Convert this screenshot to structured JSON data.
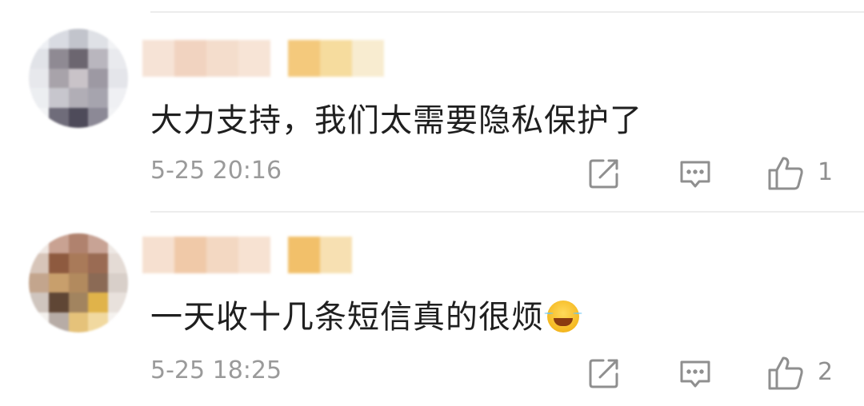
{
  "comments": [
    {
      "text": "大力支持，我们太需要隐私保护了",
      "time": "5-25 20:16",
      "likes": "1",
      "avatar_colors": [
        "#eef0f4",
        "#d9dbe2",
        "#c2c4cc",
        "#dfe1e6",
        "#f2f3f5",
        "#e1e3e8",
        "#8f8a93",
        "#6c6670",
        "#b9b6be",
        "#e9eaee",
        "#e7e8ec",
        "#a8a3aa",
        "#c9c3c8",
        "#9d99a3",
        "#e4e5ea",
        "#eceef1",
        "#c7c6cd",
        "#b1aeb6",
        "#a6a4ae",
        "#eff0f3",
        "#f3f4f6",
        "#6f6c7a",
        "#4e4b5a",
        "#8c8996",
        "#f2f3f5"
      ],
      "name_colors": [
        "#f6e3d6",
        "#f1d3c0",
        "#f4ddcc",
        "#f7e4d6",
        "gap",
        "#f4c97c",
        "#f6dc9e",
        "#f8ecd0"
      ]
    },
    {
      "text": "一天收十几条短信真的很烦",
      "time": "5-25 18:25",
      "likes": "2",
      "avatar_colors": [
        "#efe7e2",
        "#c9a292",
        "#b0826e",
        "#c8a395",
        "#eee8e4",
        "#d7c5b9",
        "#8e5a3f",
        "#a97a59",
        "#9a6b53",
        "#e4dbd5",
        "#c3a58d",
        "#c89f6c",
        "#b28a5e",
        "#8b6a55",
        "#d8cfc9",
        "#cfc5be",
        "#5f4635",
        "#a2845f",
        "#e0b34a",
        "#e8e1dc",
        "#f4f1ee",
        "#b7aca6",
        "#e5c27a",
        "#f1d9a0",
        "#f5f2ef"
      ],
      "name_colors": [
        "#f6e0d0",
        "#f0c9a8",
        "#f3d8c2",
        "#f7e2d2",
        "gap",
        "#f2c06a",
        "#f7e0b2"
      ]
    }
  ],
  "icons": {
    "share": "share-icon",
    "reply": "comment-icon",
    "like": "thumbs-up-icon"
  },
  "colors": {
    "text": "#1f1f1f",
    "meta": "#9a9a9a",
    "icon": "#8f8f8f"
  }
}
